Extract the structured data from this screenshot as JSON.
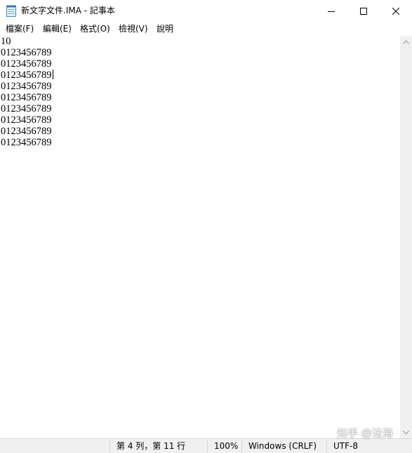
{
  "window": {
    "title": "新文字文件.IMA - 記事本"
  },
  "menu": [
    {
      "label": "檔案(F)"
    },
    {
      "label": "編輯(E)"
    },
    {
      "label": "格式(O)"
    },
    {
      "label": "檢視(V)"
    },
    {
      "label": "說明"
    }
  ],
  "editor": {
    "lines": [
      "10",
      "0123456789",
      "0123456789",
      "0123456789",
      "0123456789",
      "0123456789",
      "0123456789",
      "0123456789",
      "0123456789",
      "0123456789"
    ],
    "caret_line": 4
  },
  "statusbar": {
    "position": "第 4 列，第 11 行",
    "zoom": "100%",
    "line_ending": "Windows (CRLF)",
    "encoding": "UTF-8"
  },
  "watermark": {
    "text": "知乎 @法海"
  },
  "icons": {
    "app": "notepad-icon",
    "minimize": "minimize-icon",
    "maximize": "maximize-icon",
    "close": "close-icon",
    "scroll_up": "chevron-up-icon",
    "scroll_down": "chevron-down-icon"
  }
}
